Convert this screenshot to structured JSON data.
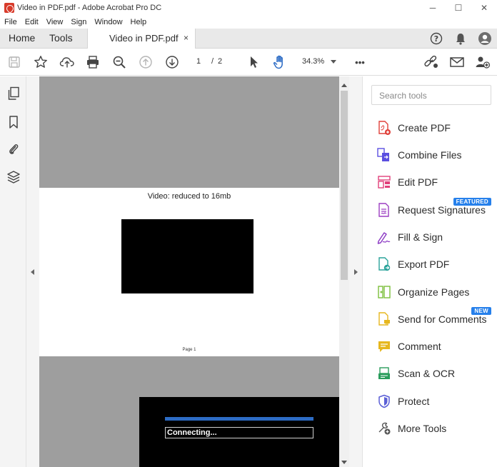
{
  "window": {
    "title": "Video in PDF.pdf - Adobe Acrobat Pro DC",
    "minimize": "─",
    "maximize": "☐",
    "close": "✕"
  },
  "menu": [
    "File",
    "Edit",
    "View",
    "Sign",
    "Window",
    "Help"
  ],
  "tabs": {
    "home": "Home",
    "tools": "Tools",
    "document": "Video in PDF.pdf",
    "close": "×"
  },
  "toolbar": {
    "page_current": "1",
    "page_separator": "/",
    "page_total": "2",
    "zoom": "34.3%",
    "more": "•••"
  },
  "document": {
    "video_title": "Video: reduced to 16mb",
    "page_label": "Page 1",
    "player_status": "Connecting..."
  },
  "tools_pane": {
    "search_placeholder": "Search tools",
    "items": [
      {
        "label": "Create PDF",
        "icon": "create-pdf-icon",
        "color": "#e0403a"
      },
      {
        "label": "Combine Files",
        "icon": "combine-files-icon",
        "color": "#5b4fe0"
      },
      {
        "label": "Edit PDF",
        "icon": "edit-pdf-icon",
        "color": "#e0407a"
      },
      {
        "label": "Request Signatures",
        "icon": "request-signatures-icon",
        "color": "#9c3fc2",
        "badge": "FEATURED"
      },
      {
        "label": "Fill & Sign",
        "icon": "fill-sign-icon",
        "color": "#8f3fc6"
      },
      {
        "label": "Export PDF",
        "icon": "export-pdf-icon",
        "color": "#2aa39a"
      },
      {
        "label": "Organize Pages",
        "icon": "organize-pages-icon",
        "color": "#7cbf3b"
      },
      {
        "label": "Send for Comments",
        "icon": "send-comments-icon",
        "color": "#e6b71e",
        "badge": "NEW"
      },
      {
        "label": "Comment",
        "icon": "comment-icon",
        "color": "#e6b71e"
      },
      {
        "label": "Scan & OCR",
        "icon": "scan-ocr-icon",
        "color": "#2a9d5c"
      },
      {
        "label": "Protect",
        "icon": "protect-icon",
        "color": "#5b5fd6"
      },
      {
        "label": "More Tools",
        "icon": "more-tools-icon",
        "color": "#555555"
      }
    ]
  },
  "colors": {
    "accent": "#2680eb",
    "hand_tool_active": "#2d6cc5",
    "progress_bar": "#2d6cc5"
  }
}
